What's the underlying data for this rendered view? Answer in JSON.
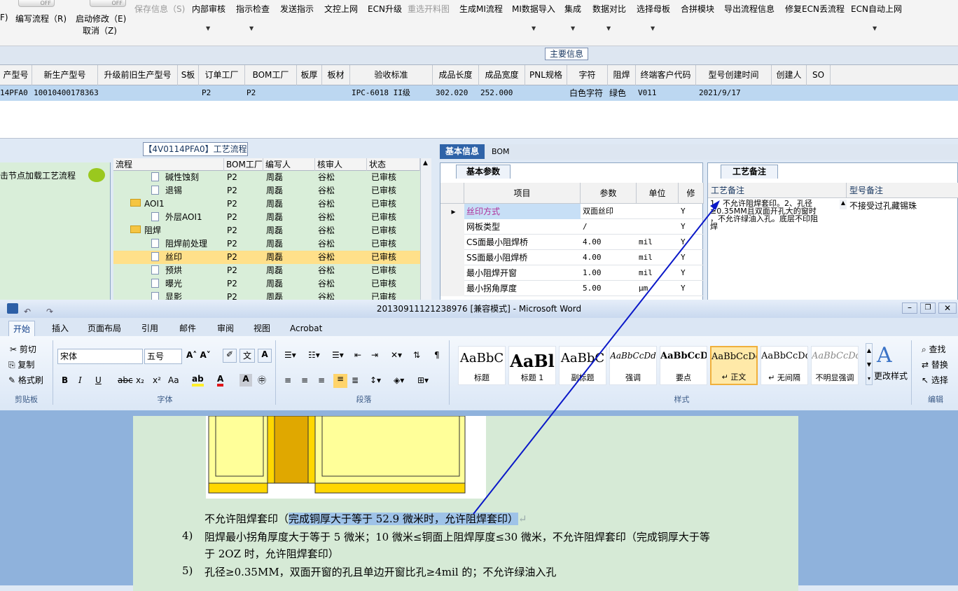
{
  "toolbar": {
    "toggle_text": "OFF",
    "partial_left": "F)",
    "items": [
      {
        "label": "编写流程（R)",
        "enabled": true
      },
      {
        "label": "启动修改（E)",
        "label2": "取消（Z)",
        "enabled": true
      },
      {
        "label": "保存信息（S)",
        "enabled": false
      },
      {
        "label": "内部审核",
        "enabled": true
      },
      {
        "label": "指示检查",
        "enabled": true
      },
      {
        "label": "发送指示",
        "enabled": true
      },
      {
        "label": "文控上网",
        "enabled": true
      },
      {
        "label": "ECN升级",
        "enabled": true
      },
      {
        "label": "重选开料图",
        "enabled": false
      },
      {
        "label": "生成MI流程",
        "enabled": true
      },
      {
        "label": "MI数据导入",
        "enabled": true
      },
      {
        "label": "集成",
        "enabled": true
      },
      {
        "label": "数据对比",
        "enabled": true
      },
      {
        "label": "选择母板",
        "enabled": true
      },
      {
        "label": "合拼模块",
        "enabled": true
      },
      {
        "label": "导出流程信息",
        "enabled": true
      },
      {
        "label": "修复ECN丢流程",
        "enabled": true
      },
      {
        "label": "ECN自动上网",
        "enabled": true
      }
    ]
  },
  "main_info": {
    "title": "主要信息",
    "columns": [
      "产型号",
      "新生产型号",
      "升级前旧生产型号",
      "S板",
      "订单工厂",
      "BOM工厂",
      "板厚",
      "板材",
      "验收标准",
      "成品长度",
      "成品宽度",
      "PNL规格",
      "字符",
      "阻焊",
      "终端客户代码",
      "型号创建时间",
      "创建人",
      "SO"
    ],
    "row": [
      "14PFA0",
      "10010400178363",
      "",
      "",
      "P2",
      "P2",
      "",
      "",
      "IPC-6018 II级",
      "302.020",
      "252.000",
      "",
      "白色字符",
      "绿色",
      "V011",
      "2021/9/17",
      "",
      ""
    ]
  },
  "left_panel": {
    "load_text": "击节点加载工艺流程"
  },
  "flow": {
    "title": "【4V0114PFA0】工艺流程",
    "columns": [
      "流程",
      "BOM工厂",
      "编写人",
      "核审人",
      "状态"
    ],
    "rows": [
      {
        "name": "碱性蚀刻",
        "type": "doc",
        "level": 2,
        "bom": "P2",
        "writer": "周磊",
        "reviewer": "谷松",
        "status": "已审核",
        "selected": false
      },
      {
        "name": "退锡",
        "type": "doc",
        "level": 2,
        "bom": "P2",
        "writer": "周磊",
        "reviewer": "谷松",
        "status": "已审核",
        "selected": false
      },
      {
        "name": "AOI1",
        "type": "folder",
        "level": 1,
        "bom": "P2",
        "writer": "周磊",
        "reviewer": "谷松",
        "status": "已审核",
        "selected": false
      },
      {
        "name": "外层AOI1",
        "type": "doc",
        "level": 2,
        "bom": "P2",
        "writer": "周磊",
        "reviewer": "谷松",
        "status": "已审核",
        "selected": false
      },
      {
        "name": "阻焊",
        "type": "folder",
        "level": 1,
        "bom": "P2",
        "writer": "周磊",
        "reviewer": "谷松",
        "status": "已审核",
        "selected": false
      },
      {
        "name": "阻焊前处理",
        "type": "doc",
        "level": 2,
        "bom": "P2",
        "writer": "周磊",
        "reviewer": "谷松",
        "status": "已审核",
        "selected": false
      },
      {
        "name": "丝印",
        "type": "doc",
        "level": 2,
        "bom": "P2",
        "writer": "周磊",
        "reviewer": "谷松",
        "status": "已审核",
        "selected": true
      },
      {
        "name": "预烘",
        "type": "doc",
        "level": 2,
        "bom": "P2",
        "writer": "周磊",
        "reviewer": "谷松",
        "status": "已审核",
        "selected": false
      },
      {
        "name": "曝光",
        "type": "doc",
        "level": 2,
        "bom": "P2",
        "writer": "周磊",
        "reviewer": "谷松",
        "status": "已审核",
        "selected": false
      },
      {
        "name": "显影",
        "type": "doc",
        "level": 2,
        "bom": "P2",
        "writer": "周磊",
        "reviewer": "谷松",
        "status": "已审核",
        "selected": false
      }
    ]
  },
  "right_tabs": {
    "active": "基本信息",
    "other": "BOM"
  },
  "params": {
    "tab": "基本参数",
    "columns": [
      "项目",
      "参数",
      "单位",
      "修"
    ],
    "rows": [
      {
        "item": "丝印方式",
        "value": "双面丝印",
        "unit": "",
        "flag": "Y",
        "current": true
      },
      {
        "item": "网板类型",
        "value": "/",
        "unit": "",
        "flag": "Y",
        "current": false
      },
      {
        "item": "CS面最小阻焊桥",
        "value": "4.00",
        "unit": "mil",
        "flag": "Y",
        "current": false
      },
      {
        "item": "SS面最小阻焊桥",
        "value": "4.00",
        "unit": "mil",
        "flag": "Y",
        "current": false
      },
      {
        "item": "最小阻焊开窗",
        "value": "1.00",
        "unit": "mil",
        "flag": "Y",
        "current": false
      },
      {
        "item": "最小拐角厚度",
        "value": "5.00",
        "unit": "μm",
        "flag": "Y",
        "current": false
      }
    ]
  },
  "remarks": {
    "tab": "工艺备注",
    "col1": "工艺备注",
    "col2": "型号备注",
    "text1_lines": [
      "1、不允许阻焊套印。2、孔径",
      "≥0.35MM且双面开孔大的窗时",
      "，不允许绿油入孔。底层不印阻",
      "焊"
    ],
    "text2": "不接受过孔藏锡珠"
  },
  "word": {
    "title": "20130911121238976 [兼容模式] - Microsoft Word",
    "tabs": [
      "开始",
      "插入",
      "页面布局",
      "引用",
      "邮件",
      "审阅",
      "视图",
      "Acrobat"
    ],
    "clipboard": {
      "label": "剪贴板",
      "cut": "剪切",
      "copy": "复制",
      "painter": "格式刷"
    },
    "font": {
      "label": "字体",
      "name": "宋体",
      "size": "五号"
    },
    "paragraph": {
      "label": "段落"
    },
    "styles": {
      "label": "样式",
      "items": [
        {
          "preview": "AaBbC",
          "name": "标题"
        },
        {
          "preview": "AaBl",
          "name": "标题 1"
        },
        {
          "preview": "AaBbC",
          "name": "副标题"
        },
        {
          "preview": "AaBbCcDd",
          "name": "强调"
        },
        {
          "preview": "AaBbCcD",
          "name": "要点"
        },
        {
          "preview": "AaBbCcDd",
          "name": "↵ 正文"
        },
        {
          "preview": "AaBbCcDd",
          "name": "↵ 无间隔"
        },
        {
          "preview": "AaBbCcDd",
          "name": "不明显强调"
        }
      ],
      "change": "更改样式"
    },
    "editing": {
      "label": "编辑",
      "find": "查找",
      "replace": "替换",
      "select": "选择"
    },
    "doc": {
      "line1_prefix": "不允许阻焊套印（",
      "line1_highlight": "完成铜厚大于等于 52.9 微米时，允许阻焊套印）",
      "item4_num": "4)",
      "item4_a": "阻焊最小拐角厚度大于等于 5 微米；10 微米≤铜面上阻焊厚度≤30 微米，不允许阻焊套印（完成铜厚大于等",
      "item4_b": "于 2OZ 时，允许阻焊套印）",
      "item5_num": "5)",
      "item5": "孔径≥0.35MM，双面开窗的孔且单边开窗比孔≥4mil 的；不允许绿油入孔"
    }
  },
  "colors": {
    "accent": "#2f63a8",
    "tree_bg": "#d9eed9",
    "selected_row": "#bcd7f1",
    "selected_node": "#ffe08a",
    "arrow": "#0a18c8"
  }
}
